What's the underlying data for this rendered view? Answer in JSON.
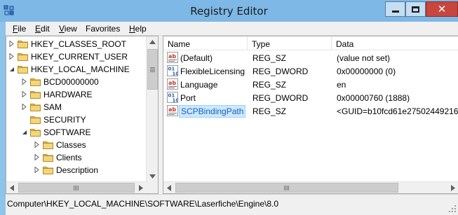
{
  "window": {
    "title": "Registry Editor"
  },
  "menu": [
    {
      "hot": "F",
      "rest": "ile"
    },
    {
      "hot": "E",
      "rest": "dit"
    },
    {
      "hot": "V",
      "rest": "iew"
    },
    {
      "hot": "",
      "rest": "Favorites"
    },
    {
      "hot": "H",
      "rest": "elp"
    }
  ],
  "tree": [
    {
      "label": "HKEY_CLASSES_ROOT",
      "level": 0,
      "expander": "collapsed"
    },
    {
      "label": "HKEY_CURRENT_USER",
      "level": 0,
      "expander": "collapsed"
    },
    {
      "label": "HKEY_LOCAL_MACHINE",
      "level": 0,
      "expander": "expanded"
    },
    {
      "label": "BCD00000000",
      "level": 1,
      "expander": "collapsed"
    },
    {
      "label": "HARDWARE",
      "level": 1,
      "expander": "collapsed"
    },
    {
      "label": "SAM",
      "level": 1,
      "expander": "collapsed"
    },
    {
      "label": "SECURITY",
      "level": 1,
      "expander": "none"
    },
    {
      "label": "SOFTWARE",
      "level": 1,
      "expander": "expanded"
    },
    {
      "label": "Classes",
      "level": 2,
      "expander": "collapsed"
    },
    {
      "label": "Clients",
      "level": 2,
      "expander": "collapsed"
    },
    {
      "label": "Description",
      "level": 2,
      "expander": "collapsed"
    }
  ],
  "columns": {
    "name": "Name",
    "type": "Type",
    "data": "Data"
  },
  "values": [
    {
      "name": "(Default)",
      "type": "REG_SZ",
      "data": "(value not set)",
      "icon": "string-value-icon",
      "selected": false
    },
    {
      "name": "FlexibleLicensing",
      "type": "REG_DWORD",
      "data": "0x00000000 (0)",
      "icon": "binary-value-icon",
      "selected": false
    },
    {
      "name": "Language",
      "type": "REG_SZ",
      "data": "en",
      "icon": "string-value-icon",
      "selected": false
    },
    {
      "name": "Port",
      "type": "REG_DWORD",
      "data": "0x00000760 (1888)",
      "icon": "binary-value-icon",
      "selected": false
    },
    {
      "name": "SCPBindingPath",
      "type": "REG_SZ",
      "data": "<GUID=b10fcd61e27502449216",
      "icon": "string-value-icon",
      "selected": true
    }
  ],
  "status": {
    "path": "Computer\\HKEY_LOCAL_MACHINE\\SOFTWARE\\Laserfiche\\Engine\\8.0"
  },
  "colors": {
    "title_bar": "#7db8e6",
    "close_button": "#c7463f",
    "selection": "#cce8ff",
    "folder": "#e8c25a"
  }
}
